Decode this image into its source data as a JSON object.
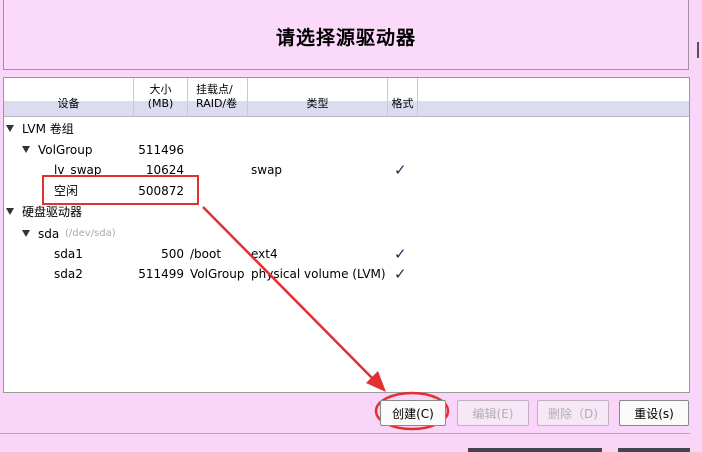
{
  "page_title": "请选择源驱动器",
  "columns": {
    "device": "设备",
    "size_line1": "大小",
    "size_line2": "(MB)",
    "mount_line1": "挂载点/",
    "mount_line2": "RAID/卷",
    "type": "类型",
    "format": "格式"
  },
  "rows": [
    {
      "name": "LVM 卷组",
      "size": "",
      "mount": "",
      "type": "",
      "format": false
    },
    {
      "name": "VolGroup",
      "size": "511496",
      "mount": "",
      "type": "",
      "format": false
    },
    {
      "name": "lv_swap",
      "size": "10624",
      "mount": "",
      "type": "swap",
      "format": true
    },
    {
      "name": "空闲",
      "size": "500872",
      "mount": "",
      "type": "",
      "format": false
    },
    {
      "name": "硬盘驱动器",
      "size": "",
      "mount": "",
      "type": "",
      "format": false
    },
    {
      "name": "sda",
      "sub": "(/dev/sda)",
      "size": "",
      "mount": "",
      "type": "",
      "format": false
    },
    {
      "name": "sda1",
      "size": "500",
      "mount": "/boot",
      "type": "ext4",
      "format": true
    },
    {
      "name": "sda2",
      "size": "511499",
      "mount": "VolGroup",
      "type": "physical volume (LVM)",
      "format": true
    }
  ],
  "check_glyph": "✓",
  "buttons": {
    "create": "创建(C)",
    "edit": "编辑(E)",
    "delete": "删除（D)",
    "reset": "重设(s)"
  },
  "colors": {
    "background": "#f9d6f9",
    "annotation": "#e03030"
  }
}
